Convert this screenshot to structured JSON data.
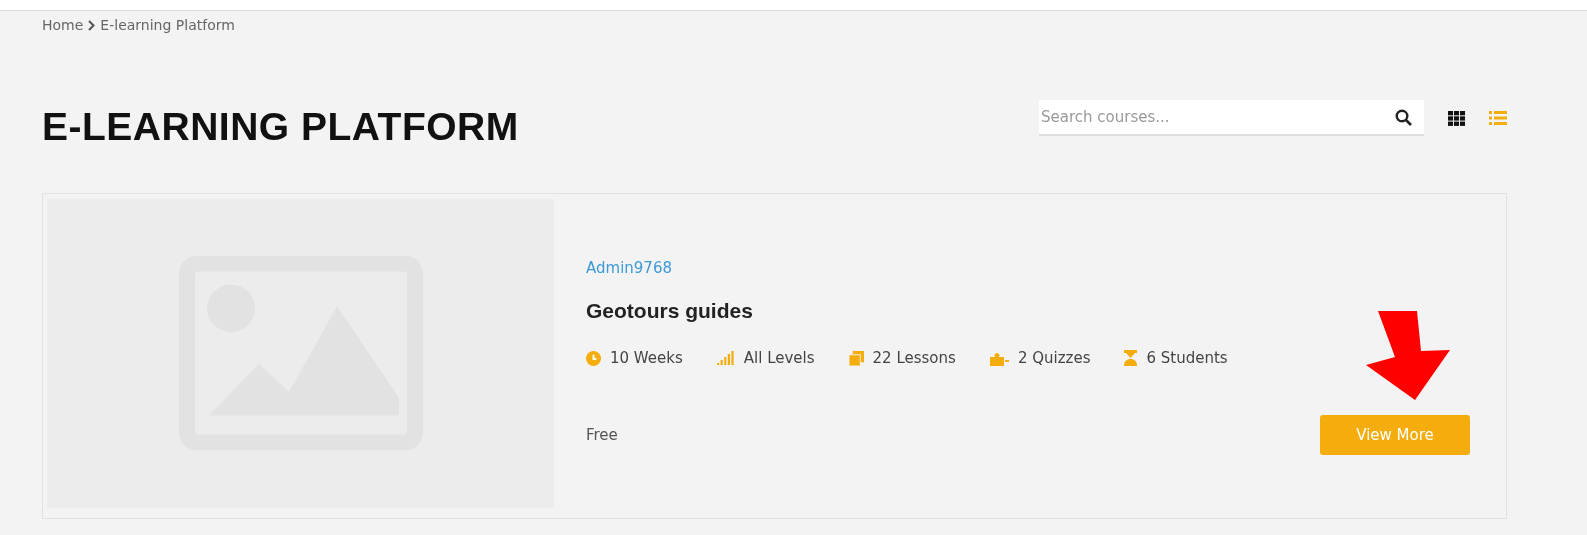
{
  "breadcrumb": {
    "items": [
      "Home",
      "E-learning Platform"
    ]
  },
  "page_title": "E-LEARNING PLATFORM",
  "search": {
    "placeholder": "Search courses..."
  },
  "view_toggle": [
    {
      "kind": "grid",
      "selected": false
    },
    {
      "kind": "list",
      "selected": true
    }
  ],
  "course": {
    "author": "Admin9768",
    "title": "Geotours guides",
    "meta": [
      {
        "kind": "duration",
        "text": "10 Weeks"
      },
      {
        "kind": "level",
        "text": "All Levels"
      },
      {
        "kind": "lessons",
        "text": "22 Lessons"
      },
      {
        "kind": "quizzes",
        "text": "2 Quizzes"
      },
      {
        "kind": "students",
        "text": "6 Students"
      }
    ],
    "price": "Free",
    "button": "View More"
  },
  "annotation": {
    "kind": "arrow"
  }
}
